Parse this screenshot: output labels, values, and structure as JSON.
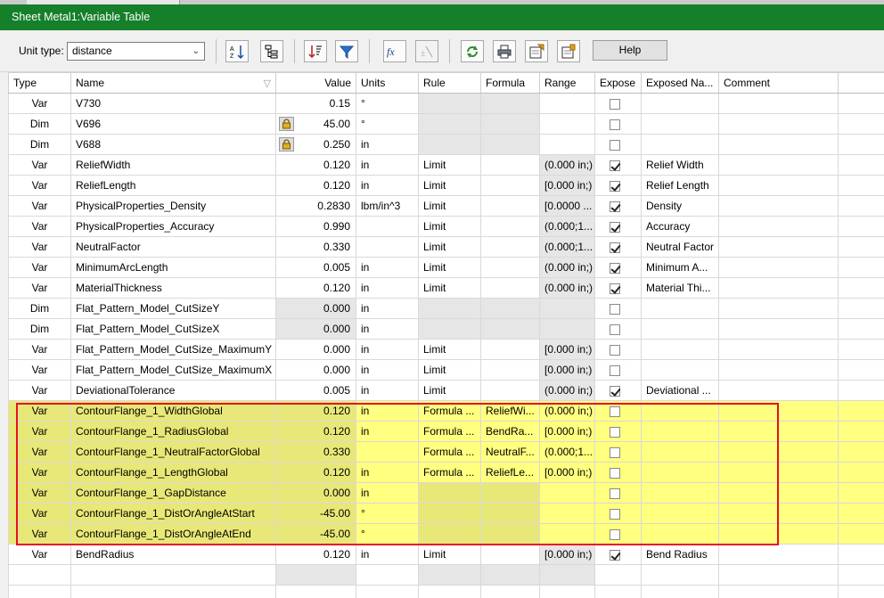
{
  "window": {
    "title": "Sheet Metal1:Variable Table"
  },
  "toolbar": {
    "unit_type_label": "Unit type:",
    "unit_type_value": "distance",
    "help_label": "Help",
    "icons": [
      "sort-ascending-icon",
      "tree-view-icon",
      "sort-descending-icon",
      "filter-icon",
      "formula-fx-icon",
      "formula-disabled-icon",
      "refresh-icon",
      "print-icon",
      "export-icon",
      "import-icon"
    ]
  },
  "columns": [
    "Type",
    "Name",
    "Value",
    "Units",
    "Rule",
    "Formula",
    "Range",
    "Expose",
    "Exposed Na...",
    "Comment"
  ],
  "rows": [
    {
      "type": "Var",
      "name": "V730",
      "value": "0.15",
      "units": "°",
      "rule": "",
      "formula": "",
      "range": "",
      "expose": false,
      "exposed_name": "",
      "comment": "",
      "lock": false,
      "hl": false,
      "value_gray": false,
      "rule_gray": true,
      "range_gray": false
    },
    {
      "type": "Dim",
      "name": "V696",
      "value": "45.00",
      "units": "°",
      "rule": "",
      "formula": "",
      "range": "",
      "expose": false,
      "exposed_name": "",
      "comment": "",
      "lock": true,
      "hl": false,
      "value_gray": false,
      "rule_gray": true,
      "range_gray": false
    },
    {
      "type": "Dim",
      "name": "V688",
      "value": "0.250",
      "units": "in",
      "rule": "",
      "formula": "",
      "range": "",
      "expose": false,
      "exposed_name": "",
      "comment": "",
      "lock": true,
      "hl": false,
      "value_gray": false,
      "rule_gray": true,
      "range_gray": false
    },
    {
      "type": "Var",
      "name": "ReliefWidth",
      "value": "0.120",
      "units": "in",
      "rule": "Limit",
      "formula": "",
      "range": "(0.000 in;)",
      "expose": true,
      "exposed_name": "Relief Width",
      "comment": "",
      "lock": false,
      "hl": false,
      "value_gray": false,
      "rule_gray": false,
      "range_gray": true
    },
    {
      "type": "Var",
      "name": "ReliefLength",
      "value": "0.120",
      "units": "in",
      "rule": "Limit",
      "formula": "",
      "range": "[0.000 in;)",
      "expose": true,
      "exposed_name": "Relief Length",
      "comment": "",
      "lock": false,
      "hl": false,
      "value_gray": false,
      "rule_gray": false,
      "range_gray": true
    },
    {
      "type": "Var",
      "name": "PhysicalProperties_Density",
      "value": "0.2830",
      "units": "lbm/in^3",
      "rule": "Limit",
      "formula": "",
      "range": "[0.0000 ...",
      "expose": true,
      "exposed_name": "Density",
      "comment": "",
      "lock": false,
      "hl": false,
      "value_gray": false,
      "rule_gray": false,
      "range_gray": true
    },
    {
      "type": "Var",
      "name": "PhysicalProperties_Accuracy",
      "value": "0.990",
      "units": "",
      "rule": "Limit",
      "formula": "",
      "range": "(0.000;1...",
      "expose": true,
      "exposed_name": "Accuracy",
      "comment": "",
      "lock": false,
      "hl": false,
      "value_gray": false,
      "rule_gray": false,
      "range_gray": true
    },
    {
      "type": "Var",
      "name": "NeutralFactor",
      "value": "0.330",
      "units": "",
      "rule": "Limit",
      "formula": "",
      "range": "(0.000;1...",
      "expose": true,
      "exposed_name": "Neutral Factor",
      "comment": "",
      "lock": false,
      "hl": false,
      "value_gray": false,
      "rule_gray": false,
      "range_gray": true
    },
    {
      "type": "Var",
      "name": "MinimumArcLength",
      "value": "0.005",
      "units": "in",
      "rule": "Limit",
      "formula": "",
      "range": "(0.000 in;)",
      "expose": true,
      "exposed_name": "Minimum A...",
      "comment": "",
      "lock": false,
      "hl": false,
      "value_gray": false,
      "rule_gray": false,
      "range_gray": true
    },
    {
      "type": "Var",
      "name": "MaterialThickness",
      "value": "0.120",
      "units": "in",
      "rule": "Limit",
      "formula": "",
      "range": "(0.000 in;)",
      "expose": true,
      "exposed_name": "Material Thi...",
      "comment": "",
      "lock": false,
      "hl": false,
      "value_gray": false,
      "rule_gray": false,
      "range_gray": true
    },
    {
      "type": "Dim",
      "name": "Flat_Pattern_Model_CutSizeY",
      "value": "0.000",
      "units": "in",
      "rule": "",
      "formula": "",
      "range": "",
      "expose": false,
      "exposed_name": "",
      "comment": "",
      "lock": false,
      "hl": false,
      "value_gray": true,
      "rule_gray": true,
      "range_gray": true
    },
    {
      "type": "Dim",
      "name": "Flat_Pattern_Model_CutSizeX",
      "value": "0.000",
      "units": "in",
      "rule": "",
      "formula": "",
      "range": "",
      "expose": false,
      "exposed_name": "",
      "comment": "",
      "lock": false,
      "hl": false,
      "value_gray": true,
      "rule_gray": true,
      "range_gray": true
    },
    {
      "type": "Var",
      "name": "Flat_Pattern_Model_CutSize_MaximumY",
      "value": "0.000",
      "units": "in",
      "rule": "Limit",
      "formula": "",
      "range": "[0.000 in;)",
      "expose": false,
      "exposed_name": "",
      "comment": "",
      "lock": false,
      "hl": false,
      "value_gray": false,
      "rule_gray": false,
      "range_gray": true
    },
    {
      "type": "Var",
      "name": "Flat_Pattern_Model_CutSize_MaximumX",
      "value": "0.000",
      "units": "in",
      "rule": "Limit",
      "formula": "",
      "range": "[0.000 in;)",
      "expose": false,
      "exposed_name": "",
      "comment": "",
      "lock": false,
      "hl": false,
      "value_gray": false,
      "rule_gray": false,
      "range_gray": true
    },
    {
      "type": "Var",
      "name": "DeviationalTolerance",
      "value": "0.005",
      "units": "in",
      "rule": "Limit",
      "formula": "",
      "range": "(0.000 in;)",
      "expose": true,
      "exposed_name": "Deviational ...",
      "comment": "",
      "lock": false,
      "hl": false,
      "value_gray": false,
      "rule_gray": false,
      "range_gray": true
    },
    {
      "type": "Var",
      "name": "ContourFlange_1_WidthGlobal",
      "value": "0.120",
      "units": "in",
      "rule": "Formula ...",
      "formula": "ReliefWi...",
      "range": "(0.000 in;)",
      "expose": false,
      "exposed_name": "",
      "comment": "",
      "lock": false,
      "hl": true,
      "value_gray": false,
      "rule_gray": false,
      "range_gray": false
    },
    {
      "type": "Var",
      "name": "ContourFlange_1_RadiusGlobal",
      "value": "0.120",
      "units": "in",
      "rule": "Formula ...",
      "formula": "BendRa...",
      "range": "[0.000 in;)",
      "expose": false,
      "exposed_name": "",
      "comment": "",
      "lock": false,
      "hl": true,
      "value_gray": false,
      "rule_gray": false,
      "range_gray": false
    },
    {
      "type": "Var",
      "name": "ContourFlange_1_NeutralFactorGlobal",
      "value": "0.330",
      "units": "",
      "rule": "Formula ...",
      "formula": "NeutralF...",
      "range": "(0.000;1...",
      "expose": false,
      "exposed_name": "",
      "comment": "",
      "lock": false,
      "hl": true,
      "value_gray": false,
      "rule_gray": false,
      "range_gray": false
    },
    {
      "type": "Var",
      "name": "ContourFlange_1_LengthGlobal",
      "value": "0.120",
      "units": "in",
      "rule": "Formula ...",
      "formula": "ReliefLe...",
      "range": "[0.000 in;)",
      "expose": false,
      "exposed_name": "",
      "comment": "",
      "lock": false,
      "hl": true,
      "value_gray": false,
      "rule_gray": false,
      "range_gray": false
    },
    {
      "type": "Var",
      "name": "ContourFlange_1_GapDistance",
      "value": "0.000",
      "units": "in",
      "rule": "",
      "formula": "",
      "range": "",
      "expose": false,
      "exposed_name": "",
      "comment": "",
      "lock": false,
      "hl": true,
      "value_gray": false,
      "rule_gray": true,
      "range_gray": false
    },
    {
      "type": "Var",
      "name": "ContourFlange_1_DistOrAngleAtStart",
      "value": "-45.00",
      "units": "°",
      "rule": "",
      "formula": "",
      "range": "",
      "expose": false,
      "exposed_name": "",
      "comment": "",
      "lock": false,
      "hl": true,
      "value_gray": false,
      "rule_gray": true,
      "range_gray": false
    },
    {
      "type": "Var",
      "name": "ContourFlange_1_DistOrAngleAtEnd",
      "value": "-45.00",
      "units": "°",
      "rule": "",
      "formula": "",
      "range": "",
      "expose": false,
      "exposed_name": "",
      "comment": "",
      "lock": false,
      "hl": true,
      "value_gray": false,
      "rule_gray": true,
      "range_gray": false
    },
    {
      "type": "Var",
      "name": "BendRadius",
      "value": "0.120",
      "units": "in",
      "rule": "Limit",
      "formula": "",
      "range": "[0.000 in;)",
      "expose": true,
      "exposed_name": "Bend Radius",
      "comment": "",
      "lock": false,
      "hl": false,
      "value_gray": false,
      "rule_gray": false,
      "range_gray": true
    }
  ]
}
